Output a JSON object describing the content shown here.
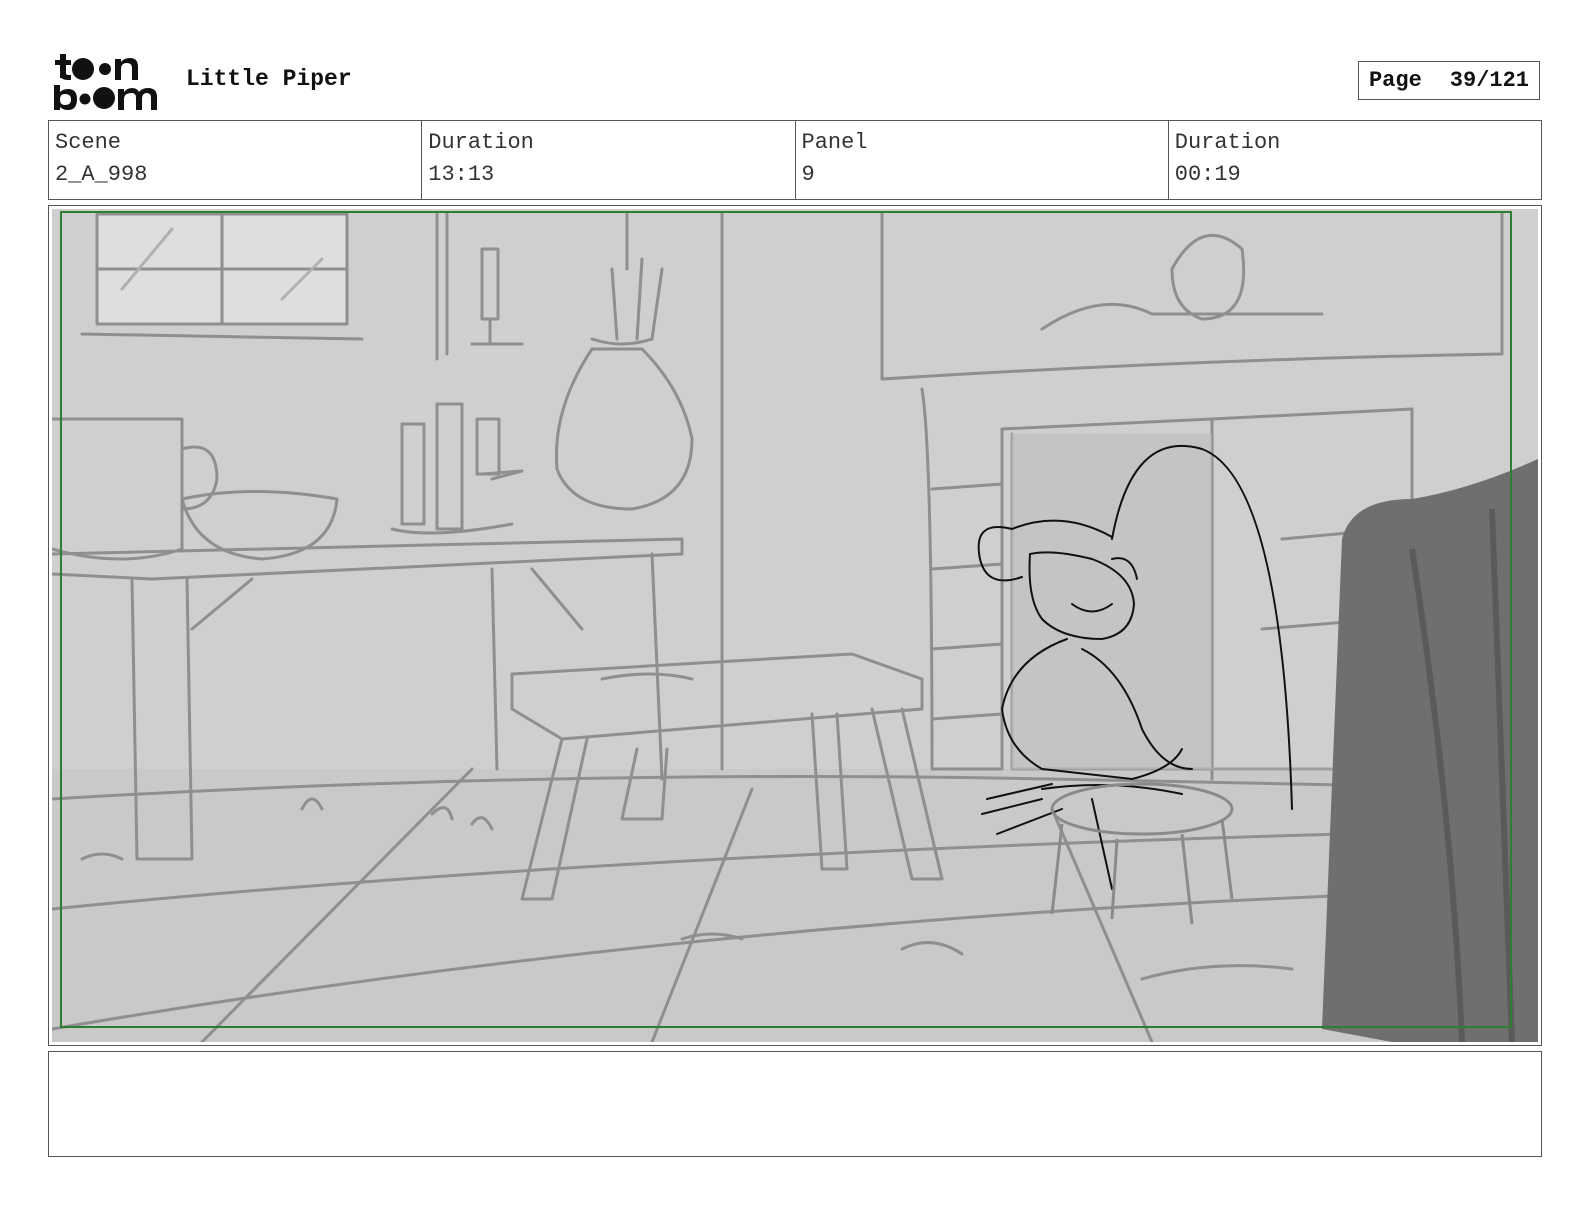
{
  "header": {
    "logo_text": "toon boom",
    "project_title": "Little Piper",
    "page_label": "Page",
    "page_number": "39/121"
  },
  "info": {
    "scene_label": "Scene",
    "scene_value": "2_A_998",
    "scene_duration_label": "Duration",
    "scene_duration_value": "13:13",
    "panel_label": "Panel",
    "panel_value": "9",
    "panel_duration_label": "Duration",
    "panel_duration_value": "00:19"
  },
  "colors": {
    "safe_frame": "#2e7d32",
    "sketch_bg": "#cfcfcf",
    "sketch_line": "#8a8a8a",
    "character_line": "#111111",
    "curtain": "#6f6f6f"
  }
}
